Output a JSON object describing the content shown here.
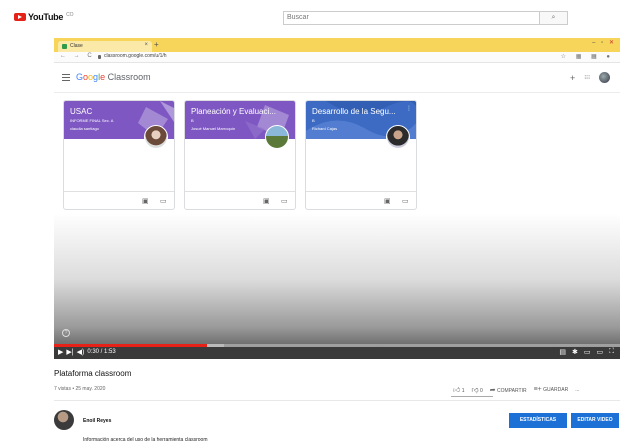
{
  "youtube": {
    "logo_text": "YouTube",
    "logo_sup": "CO",
    "search_placeholder": "Buscar",
    "search_icon": "search-icon"
  },
  "browser": {
    "tab_title": "Clase",
    "tab_close": "×",
    "new_tab": "+",
    "url": "classroom.google.com/u/1/h",
    "nav_glyphs": "← → C",
    "right_glyphs": "☆ ▦ ▦ ●",
    "window_controls": "– ▫"
  },
  "classroom": {
    "brand_google": [
      "G",
      "o",
      "o",
      "g",
      "l",
      "e"
    ],
    "brand_product": "Classroom",
    "add_icon": "+",
    "apps_icon": "⋮⋮⋮",
    "cards": [
      {
        "name": "USAC",
        "section": "INFORME FINAL Sec. A",
        "teacher": "claudia santiago",
        "color": "#7e57c2"
      },
      {
        "name": "Planeación y Evaluaci...",
        "section": "B",
        "teacher": "Josué Manuel Marroquín",
        "color": "#7e57c2"
      },
      {
        "name": "Desarrollo de la Segu...",
        "section": "B",
        "teacher": "Richard Cajas",
        "color": "#3d6bc4"
      }
    ],
    "card_footer_icons": [
      "assignment-icon",
      "folder-icon"
    ]
  },
  "player": {
    "time": "0:30 / 1:53",
    "progress_fraction": 0.27,
    "buffered_fraction": 0.3,
    "left_glyphs": "▶ ▶| ◀)",
    "right_glyphs": "▤ ✱ ▭ ▭ ⛶"
  },
  "video": {
    "title": "Plataforma classroom",
    "meta": "7 vistas • 25 may. 2020",
    "likes": "1",
    "dislikes": "0",
    "share_label": "COMPARTIR",
    "save_label": "GUARDAR",
    "more": "..."
  },
  "channel": {
    "name": "Enoil Reyes",
    "description": "Información acerca del uso de la herramienta classroom",
    "stats_button": "ESTADÍSTICAS",
    "edit_button": "EDITAR VIDEO"
  },
  "colors": {
    "youtube_red": "#e62117",
    "tab_yellow": "#f6d55a",
    "card_purple": "#7e57c2",
    "card_blue": "#3d6bc4",
    "button_blue": "#1d70d6"
  }
}
